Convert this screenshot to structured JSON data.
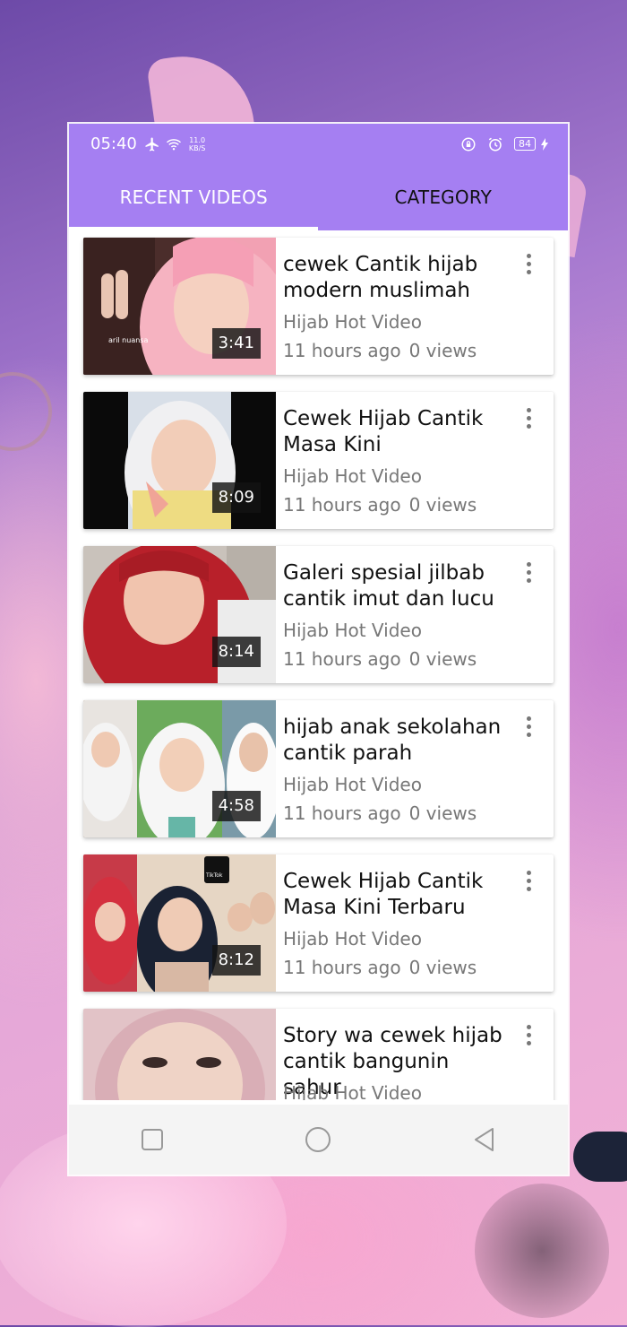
{
  "status_bar": {
    "time": "05:40",
    "network_speed": "11.0",
    "network_unit": "KB/S",
    "battery": "84"
  },
  "tabs": [
    {
      "label": "RECENT VIDEOS",
      "active": true
    },
    {
      "label": "CATEGORY",
      "active": false
    }
  ],
  "videos": [
    {
      "title": "cewek Cantik hijab modern muslimah",
      "channel": "Hijab Hot Video",
      "age": "11 hours ago",
      "views": "0 views",
      "duration": "3:41",
      "thumb_watermark": "aril nuansa"
    },
    {
      "title": "Cewek Hijab Cantik Masa Kini",
      "channel": "Hijab Hot Video",
      "age": "11 hours ago",
      "views": "0 views",
      "duration": "8:09"
    },
    {
      "title": "Galeri spesial jilbab cantik imut dan lucu",
      "channel": "Hijab Hot Video",
      "age": "11 hours ago",
      "views": "0 views",
      "duration": "8:14"
    },
    {
      "title": "hijab anak sekolahan cantik parah",
      "channel": "Hijab Hot Video",
      "age": "11 hours ago",
      "views": "0 views",
      "duration": "4:58"
    },
    {
      "title": "Cewek Hijab Cantik Masa Kini Terbaru",
      "channel": "Hijab Hot Video",
      "age": "11 hours ago",
      "views": "0 views",
      "duration": "8:12",
      "thumb_badge": "TikTok"
    },
    {
      "title": "Story wa cewek hijab cantik bangunin sahur",
      "channel": "Hijab Hot Video"
    }
  ],
  "colors": {
    "accent": "#a57ff2",
    "tab_indicator": "#ffffff",
    "secondary_text": "#777777"
  },
  "nav_icons": [
    "recents-square-icon",
    "home-circle-icon",
    "back-triangle-icon"
  ]
}
